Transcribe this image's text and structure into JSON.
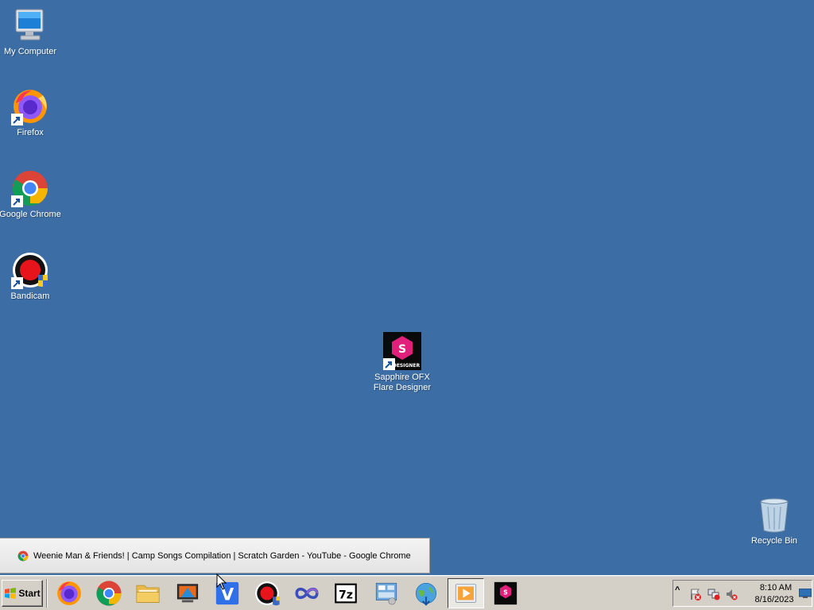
{
  "desktop": {
    "background_color": "#3c6ea5",
    "icons": [
      {
        "label": "My Computer",
        "icon": "my-computer-icon"
      },
      {
        "label": "Firefox",
        "icon": "firefox-icon"
      },
      {
        "label": "Google Chrome",
        "icon": "chrome-icon"
      },
      {
        "label": "Bandicam",
        "icon": "bandicam-icon"
      },
      {
        "label": "Sapphire OFX\nFlare Designer",
        "icon": "sapphire-flare-designer-icon",
        "badge_letter": "S",
        "badge_text": "DESIGNER"
      },
      {
        "label": "Recycle Bin",
        "icon": "recycle-bin-icon"
      }
    ]
  },
  "tooltip": {
    "text": "Weenie Man & Friends! | Camp Songs Compilation | Scratch Garden - YouTube - Google Chrome",
    "icon": "chrome-icon"
  },
  "taskbar": {
    "start_label": "Start",
    "pinned": [
      {
        "name": "firefox",
        "icon": "firefox-icon"
      },
      {
        "name": "chrome",
        "icon": "chrome-icon"
      },
      {
        "name": "file-explorer",
        "icon": "folder-icon"
      },
      {
        "name": "media-app",
        "icon": "media-app-icon"
      },
      {
        "name": "v-app",
        "icon": "v-app-icon",
        "letter": "V"
      },
      {
        "name": "bandicam",
        "icon": "bandicam-icon"
      },
      {
        "name": "infinity-app",
        "icon": "infinity-icon"
      },
      {
        "name": "7zip",
        "icon": "7zip-icon",
        "letter": "7z"
      },
      {
        "name": "control-panel",
        "icon": "control-panel-icon"
      },
      {
        "name": "network-app",
        "icon": "network-globe-icon"
      },
      {
        "name": "media-player",
        "icon": "media-player-icon",
        "active": true
      },
      {
        "name": "sapphire-flare-designer",
        "icon": "sapphire-flare-designer-icon",
        "letter": "S"
      }
    ],
    "tray": {
      "expand_symbol": "^",
      "time": "8:10 AM",
      "date": "8/16/2023"
    }
  }
}
